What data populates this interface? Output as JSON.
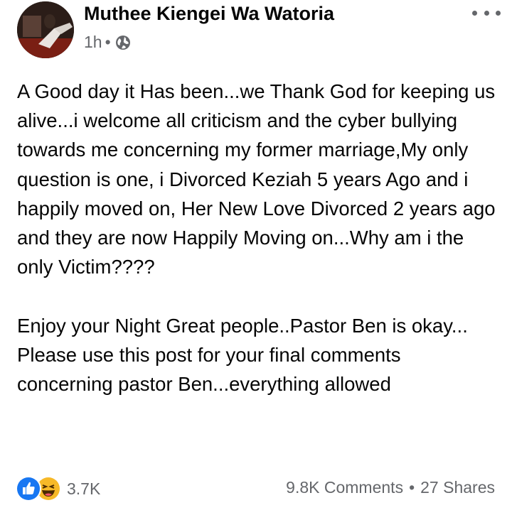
{
  "post": {
    "author": "Muthee Kiengei Wa Watoria",
    "time": "1h",
    "dot": "•",
    "privacy_icon": "globe-icon",
    "more_icon": "more-options-icon",
    "body": "A Good day it Has been...we Thank God for keeping us alive...i welcome all criticism and the cyber bullying towards me concerning my former marriage,My only question is one, i Divorced Keziah 5 years Ago and i happily moved on, Her New Love Divorced 2 years ago and they are now Happily Moving on...Why am i the only Victim????\n\nEnjoy your Night Great people..Pastor Ben is okay...\nPlease use this post for your final comments concerning pastor Ben...everything allowed"
  },
  "footer": {
    "reaction_icons": [
      "like-icon",
      "haha-icon"
    ],
    "reaction_count": "3.7K",
    "comments": "9.8K Comments",
    "separator": "•",
    "shares": "27 Shares"
  },
  "colors": {
    "like_blue": "#1877f2",
    "haha_yellow": "#f7b928",
    "secondary_text": "#65676b"
  }
}
